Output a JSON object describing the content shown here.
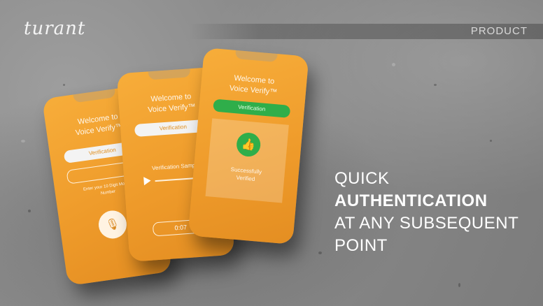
{
  "brand": {
    "logo": "turant"
  },
  "header": {
    "section": "PRODUCT"
  },
  "headline": {
    "line1": "QUICK",
    "line2": "AUTHENTICATION",
    "line3": "AT ANY SUBSEQUENT",
    "line4": "POINT"
  },
  "phones": [
    {
      "title_line1": "Welcome to",
      "title_line2": "Voice Verify™",
      "button": "Verification",
      "hint_line1": "Enter your 10 Digit Mobile",
      "hint_line2": "Number",
      "icon": "microphone-icon"
    },
    {
      "title_line1": "Welcome to",
      "title_line2": "Voice Verify™",
      "button": "Verification",
      "sample_label": "Verification Sample",
      "timer": "0:07",
      "icon": "play-icon"
    },
    {
      "title_line1": "Welcome to",
      "title_line2": "Voice Verify™",
      "button": "Verification",
      "status_line1": "Successfully",
      "status_line2": "Verified",
      "icon": "thumbs-up-icon"
    }
  ],
  "colors": {
    "phone_orange": "#f0a030",
    "success_green": "#2fae4a",
    "text_white": "#ffffff"
  }
}
